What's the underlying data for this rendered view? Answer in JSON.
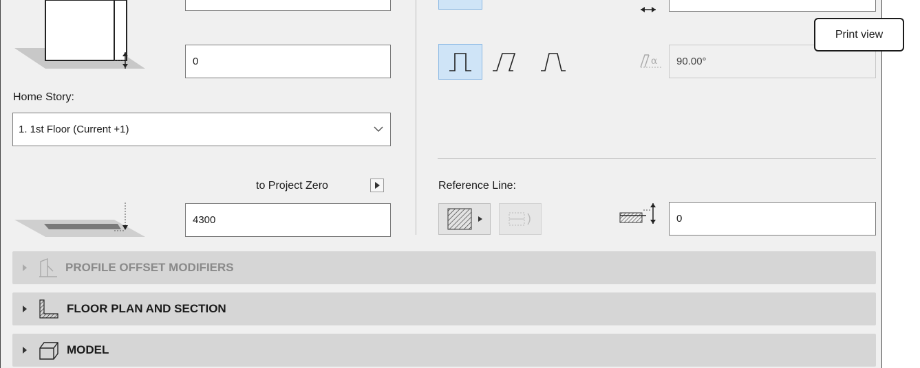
{
  "tooltip": {
    "text": "Print view"
  },
  "top": {
    "offset_value": "0",
    "home_story_label": "Home Story:",
    "home_story_selected": "1. 1st Floor (Current +1)",
    "to_project_zero_label": "to Project Zero",
    "bottom_elevation_value": "4300"
  },
  "right": {
    "angle_value": "90.00°",
    "reference_line_label": "Reference Line:",
    "ref_offset_value": "0"
  },
  "sections": [
    {
      "title": "PROFILE OFFSET MODIFIERS",
      "enabled": false
    },
    {
      "title": "FLOOR PLAN AND SECTION",
      "enabled": true
    },
    {
      "title": "MODEL",
      "enabled": true
    }
  ],
  "colors": {
    "selected_bg": "#cfe4f7",
    "section_bg": "#d6d6d6",
    "panel_bg": "#f0f0f0"
  }
}
